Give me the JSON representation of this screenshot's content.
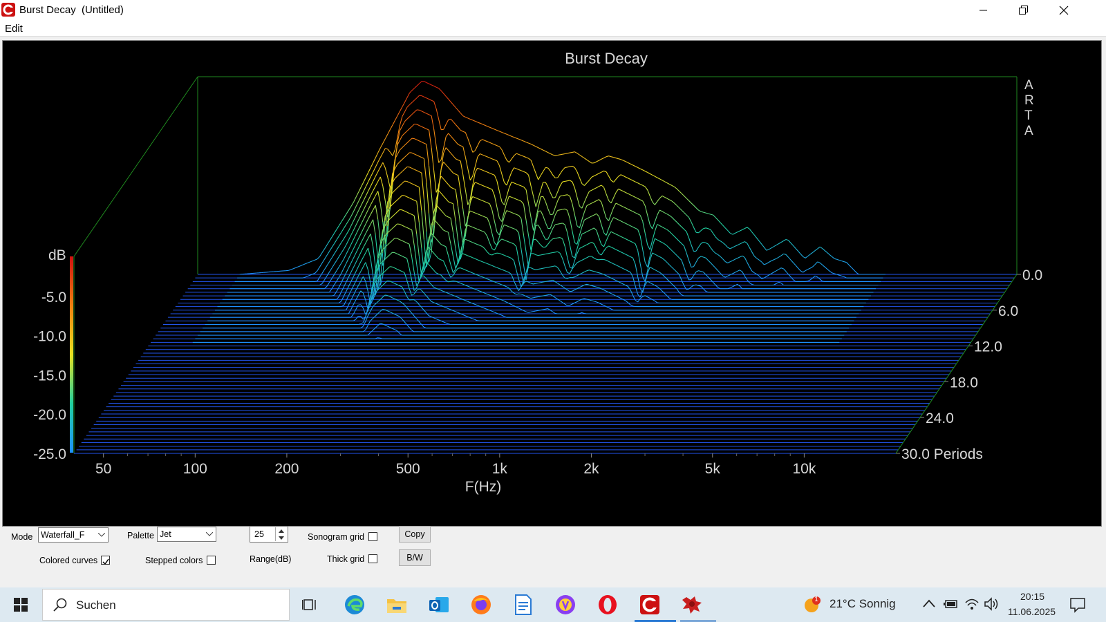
{
  "window": {
    "title": "Burst Decay  (Untitled)",
    "menu": [
      "Edit"
    ]
  },
  "chart_data": {
    "type": "waterfall",
    "title": "Burst Decay",
    "watermark": "ARTA",
    "xlabel": "F(Hz)",
    "x_ticks": [
      "50",
      "100",
      "200",
      "500",
      "1k",
      "2k",
      "5k",
      "10k"
    ],
    "x_tick_values": [
      50,
      100,
      200,
      500,
      1000,
      2000,
      5000,
      10000
    ],
    "xlim": [
      40,
      20000
    ],
    "x_scale": "log",
    "ylabel": "dB",
    "y_ticks": [
      "-5.0",
      "-10.0",
      "-15.0",
      "-20.0",
      "-25.0"
    ],
    "ylim": [
      -25,
      0
    ],
    "z_ticks": [
      "0.0",
      "6.0",
      "12.0",
      "18.0",
      "24.0",
      "30.0 Periods"
    ],
    "z_tick_values": [
      0,
      6,
      12,
      18,
      24,
      30
    ],
    "zlim": [
      0,
      30
    ],
    "palette": "Jet",
    "slices": 50,
    "envelope": {
      "freq": [
        55,
        80,
        100,
        130,
        160,
        200,
        220,
        250,
        300,
        400,
        500,
        600,
        700,
        800,
        900,
        1000,
        1200,
        1500,
        1800,
        2000,
        2300,
        2600,
        3000,
        3500,
        4000,
        4500,
        5000,
        5500,
        6000,
        7000
      ],
      "db": [
        -25,
        -24.5,
        -23,
        -16,
        -9,
        -2,
        -0.5,
        -1.5,
        -5,
        -7,
        -8.5,
        -10,
        -9.5,
        -11,
        -10,
        -10.5,
        -12,
        -14,
        -17,
        -17.5,
        -20,
        -19,
        -22,
        -20.5,
        -23,
        -21.5,
        -23,
        -23.5,
        -25,
        -25
      ]
    },
    "notches": [
      {
        "freq": 180,
        "db": -25
      },
      {
        "freq": 260,
        "db": -22
      },
      {
        "freq": 330,
        "db": -21
      },
      {
        "freq": 430,
        "db": -19
      },
      {
        "freq": 540,
        "db": -23
      },
      {
        "freq": 620,
        "db": -19
      },
      {
        "freq": 760,
        "db": -22
      },
      {
        "freq": 950,
        "db": -20
      },
      {
        "freq": 1300,
        "db": -25
      },
      {
        "freq": 1800,
        "db": -25
      },
      {
        "freq": 2100,
        "db": -22
      },
      {
        "freq": 2800,
        "db": -25
      },
      {
        "freq": 3300,
        "db": -23
      },
      {
        "freq": 4300,
        "db": -25
      },
      {
        "freq": 5200,
        "db": -24
      }
    ]
  },
  "controls": {
    "mode_label": "Mode",
    "mode_value": "Waterfall_F",
    "palette_label": "Palette",
    "palette_value": "Jet",
    "range_value": "25",
    "range_label": "Range(dB)",
    "sonogram_grid_label": "Sonogram grid",
    "sonogram_grid_checked": false,
    "thick_grid_label": "Thick grid",
    "thick_grid_checked": false,
    "colored_curves_label": "Colored curves",
    "colored_curves_checked": true,
    "stepped_colors_label": "Stepped colors",
    "stepped_colors_checked": false,
    "copy_label": "Copy",
    "bw_label": "B/W"
  },
  "taskbar": {
    "search_placeholder": "Suchen",
    "weather": "21°C  Sonnig",
    "weather_badge": "1",
    "time": "20:15",
    "date": "11.06.2025"
  },
  "colors": {
    "floor_lines": "#2255ee",
    "frame_green": "#1f8a1f",
    "taskbar_active": "#2a7ad4"
  }
}
